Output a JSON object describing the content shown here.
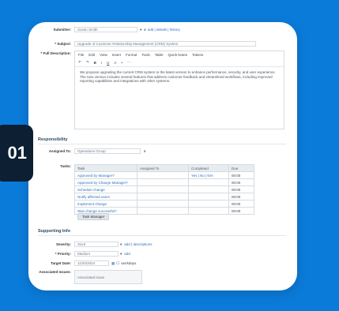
{
  "badge": "01",
  "form": {
    "submitter": {
      "label": "Submitter:",
      "value": "Susan Smith",
      "links": "add | details | history"
    },
    "subject": {
      "label": "* Subject:",
      "value": "Upgrade of Customer Relationship Management (CRM) System"
    },
    "description": {
      "label": "* Full Description:",
      "menu": [
        "File",
        "Edit",
        "View",
        "Insert",
        "Format",
        "Tools",
        "Table",
        "Quick Notes",
        "Tokens"
      ],
      "toolbar": [
        "↶",
        "↷",
        "B",
        "I",
        "U",
        "A",
        "•",
        "⋯"
      ],
      "text": "We propose upgrading the current CRM system to the latest version to enhance performance, security, and user experience. The new version includes several features that address customer feedback and streamlined workflows, including improved reporting capabilities and integrations with other systems."
    }
  },
  "responsibility": {
    "title": "Responsibility",
    "assigned_label": "Assigned To:",
    "assigned_value": "Operations Group",
    "tasks_label": "Tasks:",
    "columns": [
      "Task",
      "Assigned To",
      "Completed",
      "Due"
    ],
    "rows": [
      {
        "task": "Approved by Manager?",
        "assigned": "",
        "completed": "Yes | No | N/A",
        "due": "00:00"
      },
      {
        "task": "Approved by Change Manager?",
        "assigned": "",
        "completed": "",
        "due": "00:00"
      },
      {
        "task": "Schedule change",
        "assigned": "",
        "completed": "",
        "due": "00:00"
      },
      {
        "task": "Notify affected users",
        "assigned": "",
        "completed": "",
        "due": "00:00"
      },
      {
        "task": "Implement change",
        "assigned": "",
        "completed": "",
        "due": "00:00"
      },
      {
        "task": "Was change successful?",
        "assigned": "",
        "completed": "",
        "due": "00:00"
      }
    ],
    "task_button": "Task Manager"
  },
  "supporting": {
    "title": "Supporting Info",
    "severity": {
      "label": "Severity:",
      "value": "Sev3",
      "links": "add | descriptions"
    },
    "priority": {
      "label": "* Priority:",
      "value": "Medium",
      "links": "add"
    },
    "target_date": {
      "label": "Target Date:",
      "value": "11/20/2024",
      "extra": "workdays"
    },
    "issues": {
      "label": "Associated Issues:",
      "value": "Associated Issue"
    }
  }
}
